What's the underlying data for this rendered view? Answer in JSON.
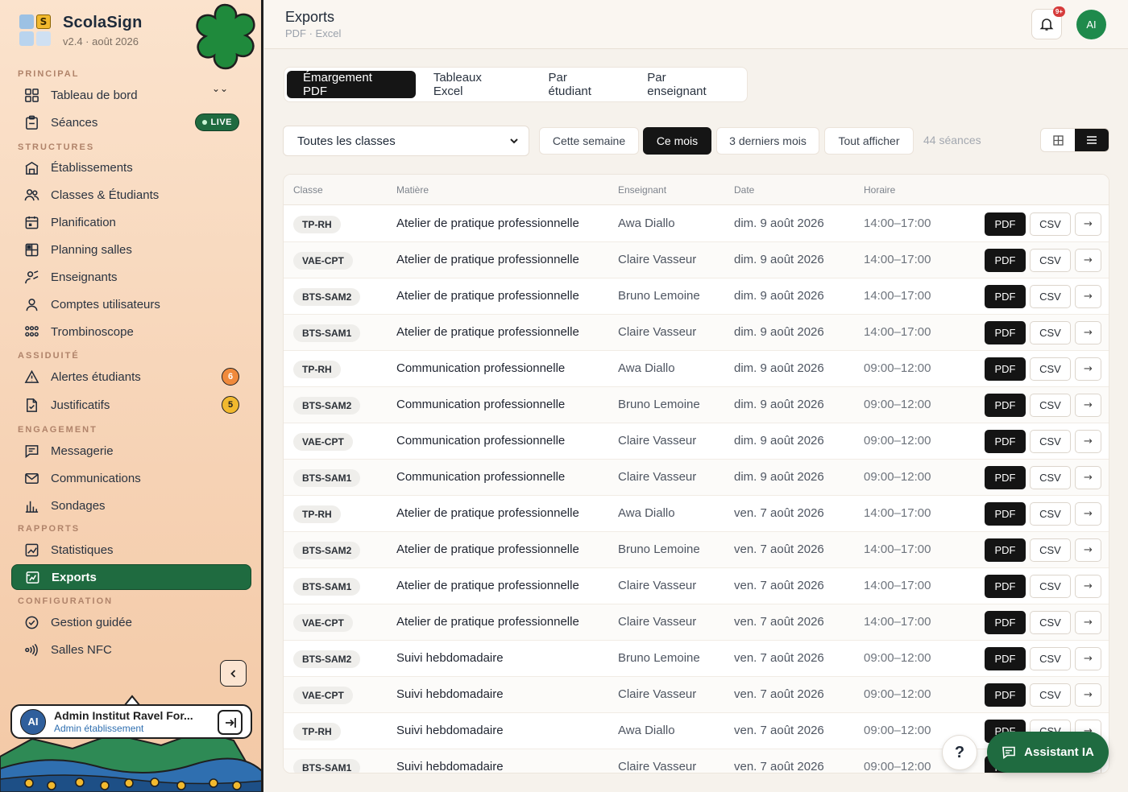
{
  "brand": {
    "name": "ScolaSign",
    "version": "v2.4 · août 2026",
    "logo_letter": "S"
  },
  "sidebar": {
    "sections": {
      "principal": "PRINCIPAL",
      "structures": "STRUCTURES",
      "assiduite": "ASSIDUITÉ",
      "engagement": "ENGAGEMENT",
      "rapports": "RAPPORTS",
      "configuration": "CONFIGURATION"
    },
    "items": {
      "dashboard": "Tableau de bord",
      "seances": "Séances",
      "etablissements": "Établissements",
      "classes": "Classes & Étudiants",
      "planification": "Planification",
      "planning_salles": "Planning salles",
      "enseignants": "Enseignants",
      "comptes": "Comptes utilisateurs",
      "trombinoscope": "Trombinoscope",
      "alertes": "Alertes étudiants",
      "justificatifs": "Justificatifs",
      "messagerie": "Messagerie",
      "communications": "Communications",
      "sondages": "Sondages",
      "statistiques": "Statistiques",
      "exports": "Exports",
      "gestion": "Gestion guidée",
      "nfc": "Salles NFC"
    },
    "live_label": "LIVE",
    "alertes_count": "6",
    "justificatifs_count": "5",
    "user": {
      "initials": "AI",
      "name": "Admin Institut Ravel For...",
      "role": "Admin établissement"
    }
  },
  "header": {
    "title": "Exports",
    "subtitle": "PDF · Excel",
    "notif_badge": "9+",
    "avatar": "AI"
  },
  "tabs": [
    "Émargement PDF",
    "Tableaux Excel",
    "Par étudiant",
    "Par enseignant"
  ],
  "filters": {
    "class_select": "Toutes les classes",
    "periods": [
      "Cette semaine",
      "Ce mois",
      "3 derniers mois",
      "Tout afficher"
    ],
    "active_period": "Ce mois",
    "count": "44 séances"
  },
  "table": {
    "headers": [
      "Classe",
      "Matière",
      "Enseignant",
      "Date",
      "Horaire"
    ],
    "pdf_label": "PDF",
    "csv_label": "CSV",
    "go_label": "→",
    "rows": [
      [
        "TP-RH",
        "Atelier de pratique professionnelle",
        "Awa Diallo",
        "dim. 9 août 2026",
        "14:00–17:00"
      ],
      [
        "VAE-CPT",
        "Atelier de pratique professionnelle",
        "Claire Vasseur",
        "dim. 9 août 2026",
        "14:00–17:00"
      ],
      [
        "BTS-SAM2",
        "Atelier de pratique professionnelle",
        "Bruno Lemoine",
        "dim. 9 août 2026",
        "14:00–17:00"
      ],
      [
        "BTS-SAM1",
        "Atelier de pratique professionnelle",
        "Claire Vasseur",
        "dim. 9 août 2026",
        "14:00–17:00"
      ],
      [
        "TP-RH",
        "Communication professionnelle",
        "Awa Diallo",
        "dim. 9 août 2026",
        "09:00–12:00"
      ],
      [
        "BTS-SAM2",
        "Communication professionnelle",
        "Bruno Lemoine",
        "dim. 9 août 2026",
        "09:00–12:00"
      ],
      [
        "VAE-CPT",
        "Communication professionnelle",
        "Claire Vasseur",
        "dim. 9 août 2026",
        "09:00–12:00"
      ],
      [
        "BTS-SAM1",
        "Communication professionnelle",
        "Claire Vasseur",
        "dim. 9 août 2026",
        "09:00–12:00"
      ],
      [
        "TP-RH",
        "Atelier de pratique professionnelle",
        "Awa Diallo",
        "ven. 7 août 2026",
        "14:00–17:00"
      ],
      [
        "BTS-SAM2",
        "Atelier de pratique professionnelle",
        "Bruno Lemoine",
        "ven. 7 août 2026",
        "14:00–17:00"
      ],
      [
        "BTS-SAM1",
        "Atelier de pratique professionnelle",
        "Claire Vasseur",
        "ven. 7 août 2026",
        "14:00–17:00"
      ],
      [
        "VAE-CPT",
        "Atelier de pratique professionnelle",
        "Claire Vasseur",
        "ven. 7 août 2026",
        "14:00–17:00"
      ],
      [
        "BTS-SAM2",
        "Suivi hebdomadaire",
        "Bruno Lemoine",
        "ven. 7 août 2026",
        "09:00–12:00"
      ],
      [
        "VAE-CPT",
        "Suivi hebdomadaire",
        "Claire Vasseur",
        "ven. 7 août 2026",
        "09:00–12:00"
      ],
      [
        "TP-RH",
        "Suivi hebdomadaire",
        "Awa Diallo",
        "ven. 7 août 2026",
        "09:00–12:00"
      ],
      [
        "BTS-SAM1",
        "Suivi hebdomadaire",
        "Claire Vasseur",
        "ven. 7 août 2026",
        "09:00–12:00"
      ]
    ]
  },
  "floating": {
    "help": "?",
    "assistant": "Assistant IA"
  },
  "colors": {
    "accent": "#1f6b40",
    "dark": "#151515",
    "alert": "#f08a3c"
  }
}
